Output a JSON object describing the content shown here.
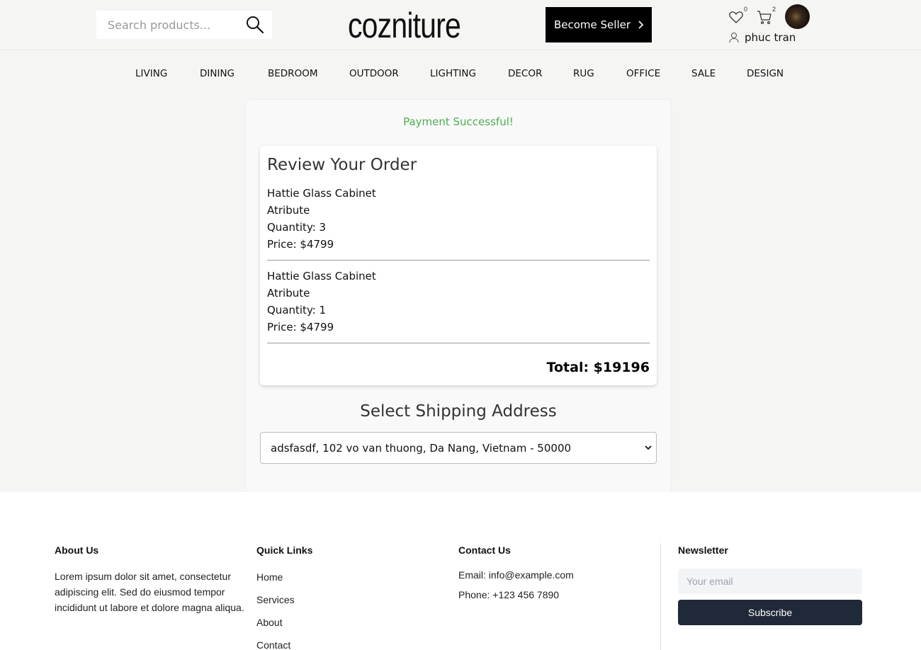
{
  "header": {
    "search_placeholder": "Search products...",
    "logo": "cozniture",
    "become_seller": "Become Seller",
    "wishlist_count": "0",
    "cart_count": "2",
    "user_name": "phuc tran"
  },
  "nav": {
    "items": [
      "LIVING",
      "DINING",
      "BEDROOM",
      "OUTDOOR",
      "LIGHTING",
      "DECOR",
      "RUG",
      "OFFICE",
      "SALE",
      "DESIGN"
    ]
  },
  "checkout": {
    "status": "Payment Successful!",
    "review_title": "Review Your Order",
    "items": [
      {
        "name": "Hattie Glass Cabinet",
        "attribute": "Atribute",
        "quantity": "Quantity: 3",
        "price": "Price: $4799"
      },
      {
        "name": "Hattie Glass Cabinet",
        "attribute": "Atribute",
        "quantity": "Quantity: 1",
        "price": "Price: $4799"
      }
    ],
    "total": "Total: $19196",
    "shipping_title": "Select Shipping Address",
    "shipping_selected": "adsfasdf, 102 vo van thuong, Da Nang, Vietnam - 50000"
  },
  "footer": {
    "about_title": "About Us",
    "about_text": "Lorem ipsum dolor sit amet, consectetur adipiscing elit. Sed do eiusmod tempor incididunt ut labore et dolore magna aliqua.",
    "links_title": "Quick Links",
    "links": [
      "Home",
      "Services",
      "About",
      "Contact"
    ],
    "contact_title": "Contact Us",
    "contact_email": "Email: info@example.com",
    "contact_phone": "Phone: +123 456 7890",
    "newsletter_title": "Newsletter",
    "newsletter_placeholder": "Your email",
    "subscribe_label": "Subscribe"
  }
}
